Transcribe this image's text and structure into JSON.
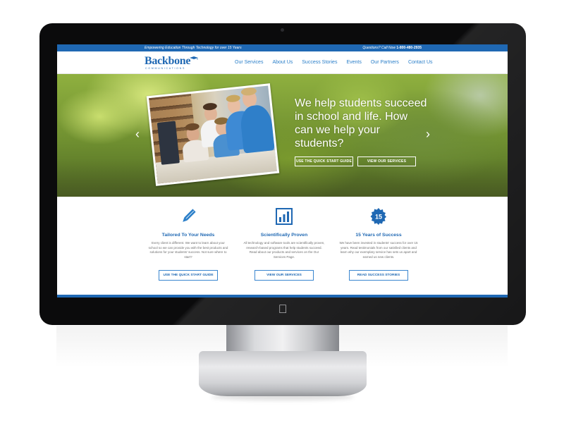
{
  "topbar": {
    "tagline": "Empowering Education Through Technology for over 15 Years",
    "question": "Questions? Call Now",
    "phone": "1-800-480-2935"
  },
  "brand": {
    "name": "Backbone",
    "subtitle": "COMMUNICATIONS"
  },
  "nav": {
    "items": [
      {
        "label": "Our Services"
      },
      {
        "label": "About Us"
      },
      {
        "label": "Success Stories"
      },
      {
        "label": "Events"
      },
      {
        "label": "Our Partners"
      },
      {
        "label": "Contact Us"
      }
    ]
  },
  "hero": {
    "headline": "We help students succeed in school and life. How can we help your students?",
    "primary_button": "USE THE QUICK START GUIDE",
    "secondary_button": "VIEW OUR SERVICES",
    "prev_icon": "chevron-left-icon",
    "next_icon": "chevron-right-icon"
  },
  "features": [
    {
      "icon": "pencil-icon",
      "title": "Tailored To Your Needs",
      "description": "Every client is different. We want to learn about your school so we can provide you with the best products and solutions for your students' success. Not sure where to start?",
      "button": "USE THE QUICK START GUIDE"
    },
    {
      "icon": "bar-chart-icon",
      "title": "Scientifically Proven",
      "description": "All technology and software tools are scientifically proven, research-based programs that help students succeed. Read about our products and services on the Our Services Page.",
      "button": "VIEW OUR SERVICES"
    },
    {
      "icon": "badge-15-icon",
      "badge_number": "15",
      "title": "15 Years of Success",
      "description": "We have been invested in students' success for over 15 years. Read testimonials from our satisfied clients and learn why our exemplary service has sets us apart and earned us new clients.",
      "button": "READ SUCCESS STORIES"
    }
  ],
  "colors": {
    "brand_blue": "#1f68b3",
    "link_blue": "#2b7fc9",
    "monitor_bezel": "#0b0b0c"
  }
}
